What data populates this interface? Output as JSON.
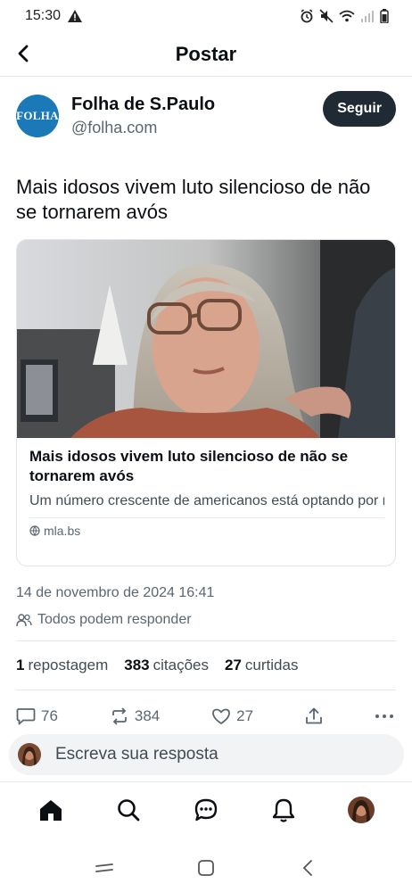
{
  "status_bar": {
    "time": "15:30"
  },
  "header": {
    "title": "Postar"
  },
  "author": {
    "avatar_text": "FOLHA",
    "name": "Folha de S.Paulo",
    "handle": "@folha.com",
    "follow_label": "Seguir"
  },
  "post": {
    "text": "Mais idosos vivem luto silencioso de não se tornarem avós"
  },
  "link_card": {
    "title": "Mais idosos vivem luto silencioso de não se tornarem avós",
    "description": "Um número crescente de americanos está optando por não ter filhos; seus pais estão lidando com o ...",
    "domain": "mla.bs"
  },
  "meta": {
    "timestamp": "14 de novembro de 2024 16:41",
    "reply_permission": "Todos podem responder"
  },
  "stats": {
    "reposts_count": "1",
    "reposts_label": "repostagem",
    "quotes_count": "383",
    "quotes_label": "citações",
    "likes_count": "27",
    "likes_label": "curtidas"
  },
  "actions": {
    "replies": "76",
    "reposts": "384",
    "likes": "27"
  },
  "reply_bar": {
    "placeholder": "Escreva sua resposta"
  },
  "colors": {
    "brand_blue": "#1a79b6",
    "follow_button": "#1f2a35",
    "muted_text": "#5b6670"
  },
  "icons": [
    "back-arrow-icon",
    "message-icon",
    "repost-icon",
    "heart-icon",
    "share-icon",
    "more-icon",
    "home-icon",
    "search-icon",
    "chat-icon",
    "bell-icon"
  ]
}
